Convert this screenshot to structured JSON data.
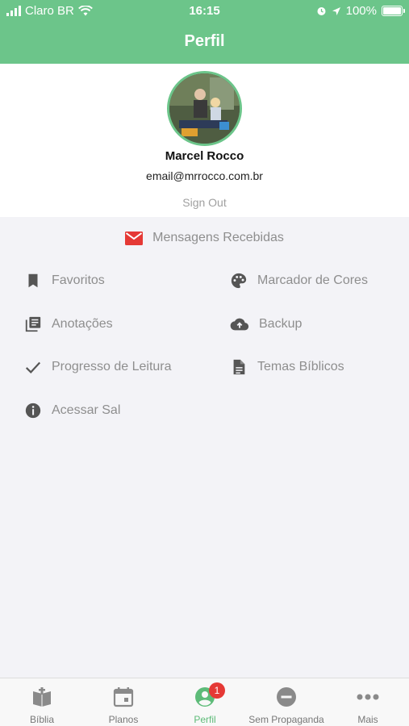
{
  "status_bar": {
    "carrier": "Claro BR",
    "time": "16:15",
    "battery": "100%"
  },
  "header": {
    "title": "Perfil"
  },
  "profile": {
    "name": "Marcel Rocco",
    "email": "email@mrrocco.com.br",
    "sign_out": "Sign Out"
  },
  "messages": {
    "label": "Mensagens Recebidas"
  },
  "menu": {
    "favoritos": "Favoritos",
    "marcador": "Marcador de Cores",
    "anotacoes": "Anotações",
    "backup": "Backup",
    "progresso": "Progresso de Leitura",
    "temas": "Temas Bíblicos",
    "sal": "Acessar Sal"
  },
  "tabs": {
    "biblia": "Bíblia",
    "planos": "Planos",
    "perfil": "Perfil",
    "perfil_badge": "1",
    "sem_propaganda": "Sem Propaganda",
    "mais": "Mais"
  },
  "colors": {
    "accent": "#6cc58a",
    "badge": "#e53935",
    "mail": "#e53935"
  }
}
